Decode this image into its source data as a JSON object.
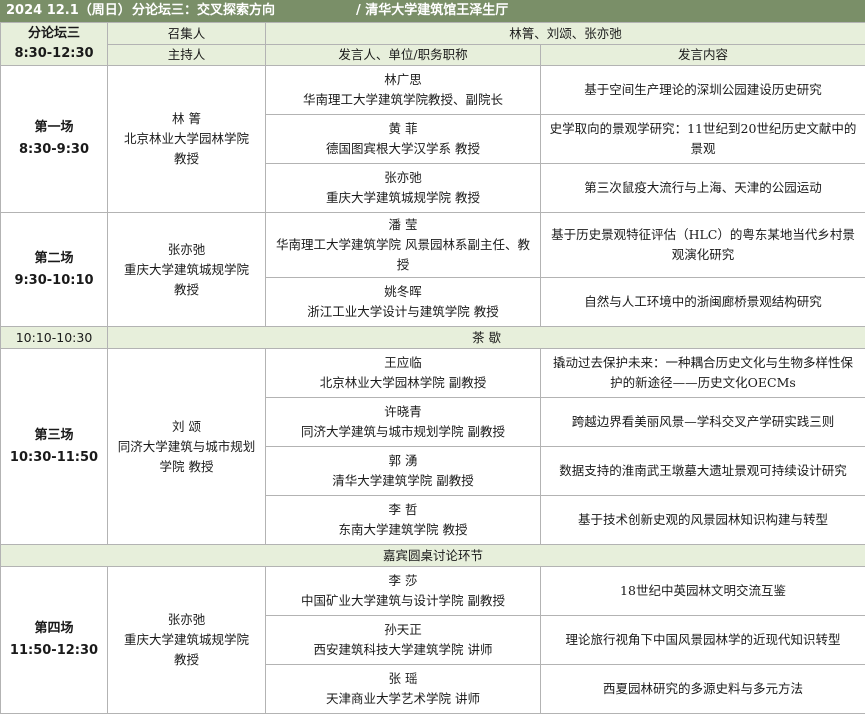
{
  "banner": {
    "date": "2024 12.1（周日）",
    "forum": "分论坛三：交叉探索方向",
    "venue": "/ 清华大学建筑馆王泽生厅"
  },
  "header": {
    "forum_name": "分论坛三",
    "forum_time": "8:30-12:30",
    "convener_label": "召集人",
    "conveners": "林箐、刘颂、张亦弛",
    "host_label": "主持人",
    "speaker_label": "发言人、单位/职务职称",
    "content_label": "发言内容"
  },
  "sessions": [
    {
      "name": "第一场",
      "time": "8:30-9:30",
      "host": {
        "name": "林  箐",
        "affiliation": "北京林业大学园林学院",
        "title": "教授"
      },
      "talks": [
        {
          "speaker": "林广思",
          "affiliation": "华南理工大学建筑学院教授、副院长",
          "topic": "基于空间生产理论的深圳公园建设历史研究"
        },
        {
          "speaker": "黄  菲",
          "affiliation": "德国图宾根大学汉学系 教授",
          "topic": "史学取向的景观学研究：11世纪到20世纪历史文献中的景观"
        },
        {
          "speaker": "张亦弛",
          "affiliation": "重庆大学建筑城规学院 教授",
          "topic": "第三次鼠疫大流行与上海、天津的公园运动"
        }
      ]
    },
    {
      "name": "第二场",
      "time": "9:30-10:10",
      "host": {
        "name": "张亦弛",
        "affiliation": "重庆大学建筑城规学院",
        "title": "教授"
      },
      "talks": [
        {
          "speaker": "潘  莹",
          "affiliation": "华南理工大学建筑学院 风景园林系副主任、教授",
          "topic": "基于历史景观特征评估（HLC）的粤东某地当代乡村景观演化研究"
        },
        {
          "speaker": "姚冬晖",
          "affiliation": "浙江工业大学设计与建筑学院 教授",
          "topic": "自然与人工环境中的浙闽廊桥景观结构研究"
        }
      ]
    },
    {
      "name": "第三场",
      "time": "10:30-11:50",
      "host": {
        "name": "刘  颂",
        "affiliation": "同济大学建筑与城市规划学院 教授",
        "title": ""
      },
      "talks": [
        {
          "speaker": "王应临",
          "affiliation": "北京林业大学园林学院 副教授",
          "topic": "撬动过去保护未来：一种耦合历史文化与生物多样性保护的新途径——历史文化OECMs"
        },
        {
          "speaker": "许晓青",
          "affiliation": "同济大学建筑与城市规划学院 副教授",
          "topic": "跨越边界看美丽风景—学科交叉产学研实践三则"
        },
        {
          "speaker": "郭  湧",
          "affiliation": "清华大学建筑学院 副教授",
          "topic": "数据支持的淮南武王墩墓大遗址景观可持续设计研究"
        },
        {
          "speaker": "李  哲",
          "affiliation": "东南大学建筑学院 教授",
          "topic": "基于技术创新史观的风景园林知识构建与转型"
        }
      ]
    },
    {
      "name": "第四场",
      "time": "11:50-12:30",
      "host": {
        "name": "张亦弛",
        "affiliation": "重庆大学建筑城规学院",
        "title": "教授"
      },
      "talks": [
        {
          "speaker": "李  莎",
          "affiliation": "中国矿业大学建筑与设计学院 副教授",
          "topic": "18世纪中英园林文明交流互鉴"
        },
        {
          "speaker": "孙天正",
          "affiliation": "西安建筑科技大学建筑学院 讲师",
          "topic": "理论旅行视角下中国风景园林学的近现代知识转型"
        },
        {
          "speaker": "张  瑶",
          "affiliation": "天津商业大学艺术学院 讲师",
          "topic": "西夏园林研究的多源史料与多元方法"
        }
      ]
    }
  ],
  "tea_break": {
    "time": "10:10-10:30",
    "label": "茶  歇"
  },
  "roundtable": {
    "label": "嘉宾圆桌讨论环节"
  }
}
